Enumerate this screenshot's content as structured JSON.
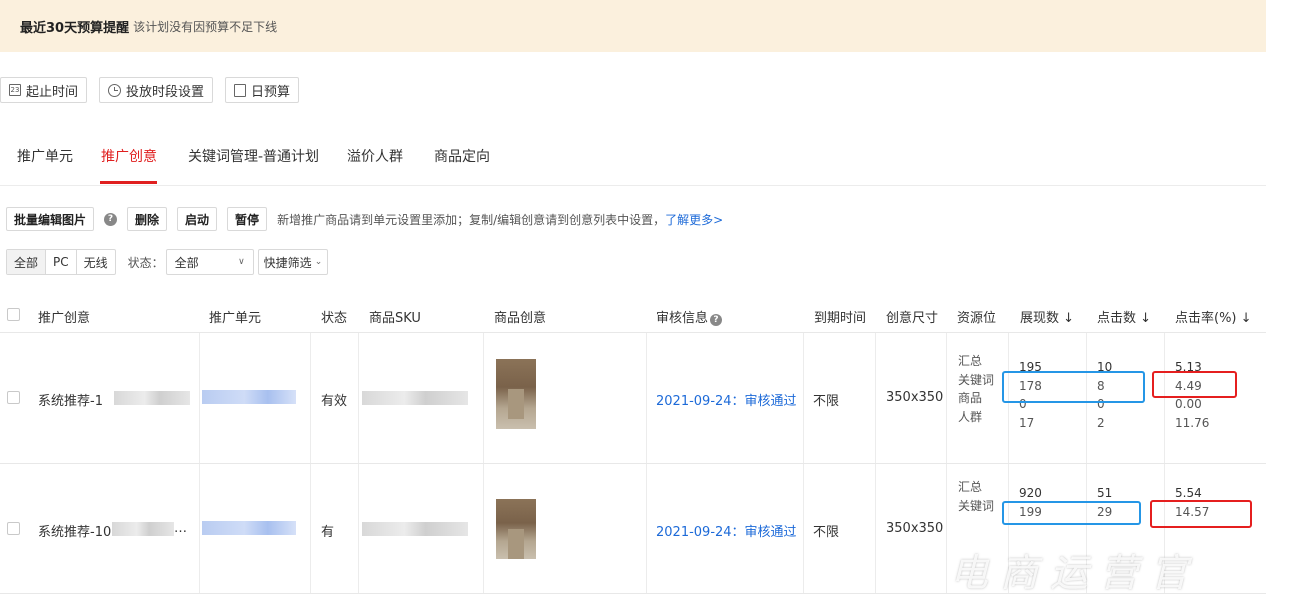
{
  "banner": {
    "title": "最近30天预算提醒",
    "desc": "该计划没有因预算不足下线"
  },
  "toolbar": [
    {
      "label": "起止时间",
      "icon": "calendar-icon"
    },
    {
      "label": "投放时段设置",
      "icon": "clock-icon"
    },
    {
      "label": "日预算",
      "icon": "budget-icon"
    }
  ],
  "tabs": [
    {
      "label": "推广单元",
      "active": false
    },
    {
      "label": "推广创意",
      "active": true
    },
    {
      "label": "关键词管理-普通计划",
      "active": false
    },
    {
      "label": "溢价人群",
      "active": false
    },
    {
      "label": "商品定向",
      "active": false
    }
  ],
  "actions": {
    "batch_edit": "批量编辑图片",
    "delete": "删除",
    "start": "启动",
    "pause": "暂停",
    "hint": "新增推广商品请到单元设置里添加；复制/编辑创意请到创意列表中设置，",
    "learn_more": "了解更多>"
  },
  "filters": {
    "segments": [
      "全部",
      "PC",
      "无线"
    ],
    "status_label": "状态：",
    "status_value": "全部",
    "quick_filter": "快捷筛选"
  },
  "table": {
    "headers": [
      "推广创意",
      "推广单元",
      "状态",
      "商品SKU",
      "商品创意",
      "审核信息",
      "到期时间",
      "创意尺寸",
      "资源位",
      "展现数 ↓",
      "点击数 ↓",
      "点击率(%) ↓"
    ],
    "rows": [
      {
        "name": "系统推荐-1",
        "status": "有效",
        "audit": "2021-09-24：审核通过",
        "expire": "不限",
        "size": "350x350",
        "resources": [
          "汇总",
          "关键词",
          "商品",
          "人群"
        ],
        "impressions": [
          "195",
          "178",
          "0",
          "17"
        ],
        "clicks": [
          "10",
          "8",
          "0",
          "2"
        ],
        "ctr": [
          "5.13",
          "4.49",
          "0.00",
          "11.76"
        ]
      },
      {
        "name": "系统推荐-10",
        "name_suffix": "…",
        "status": "有",
        "audit": "2021-09-24：审核通过",
        "expire": "不限",
        "size": "350x350",
        "resources": [
          "汇总",
          "关键词"
        ],
        "impressions": [
          "920",
          "199"
        ],
        "clicks": [
          "51",
          "29"
        ],
        "ctr": [
          "5.54",
          "14.57"
        ]
      }
    ]
  },
  "watermark": "电商运营官",
  "colors": {
    "accent_red": "#e02020",
    "link_blue": "#1d6ad8",
    "highlight_blue": "#2596e6",
    "highlight_red": "#e51f1f",
    "banner_bg": "#fbf0dd"
  }
}
